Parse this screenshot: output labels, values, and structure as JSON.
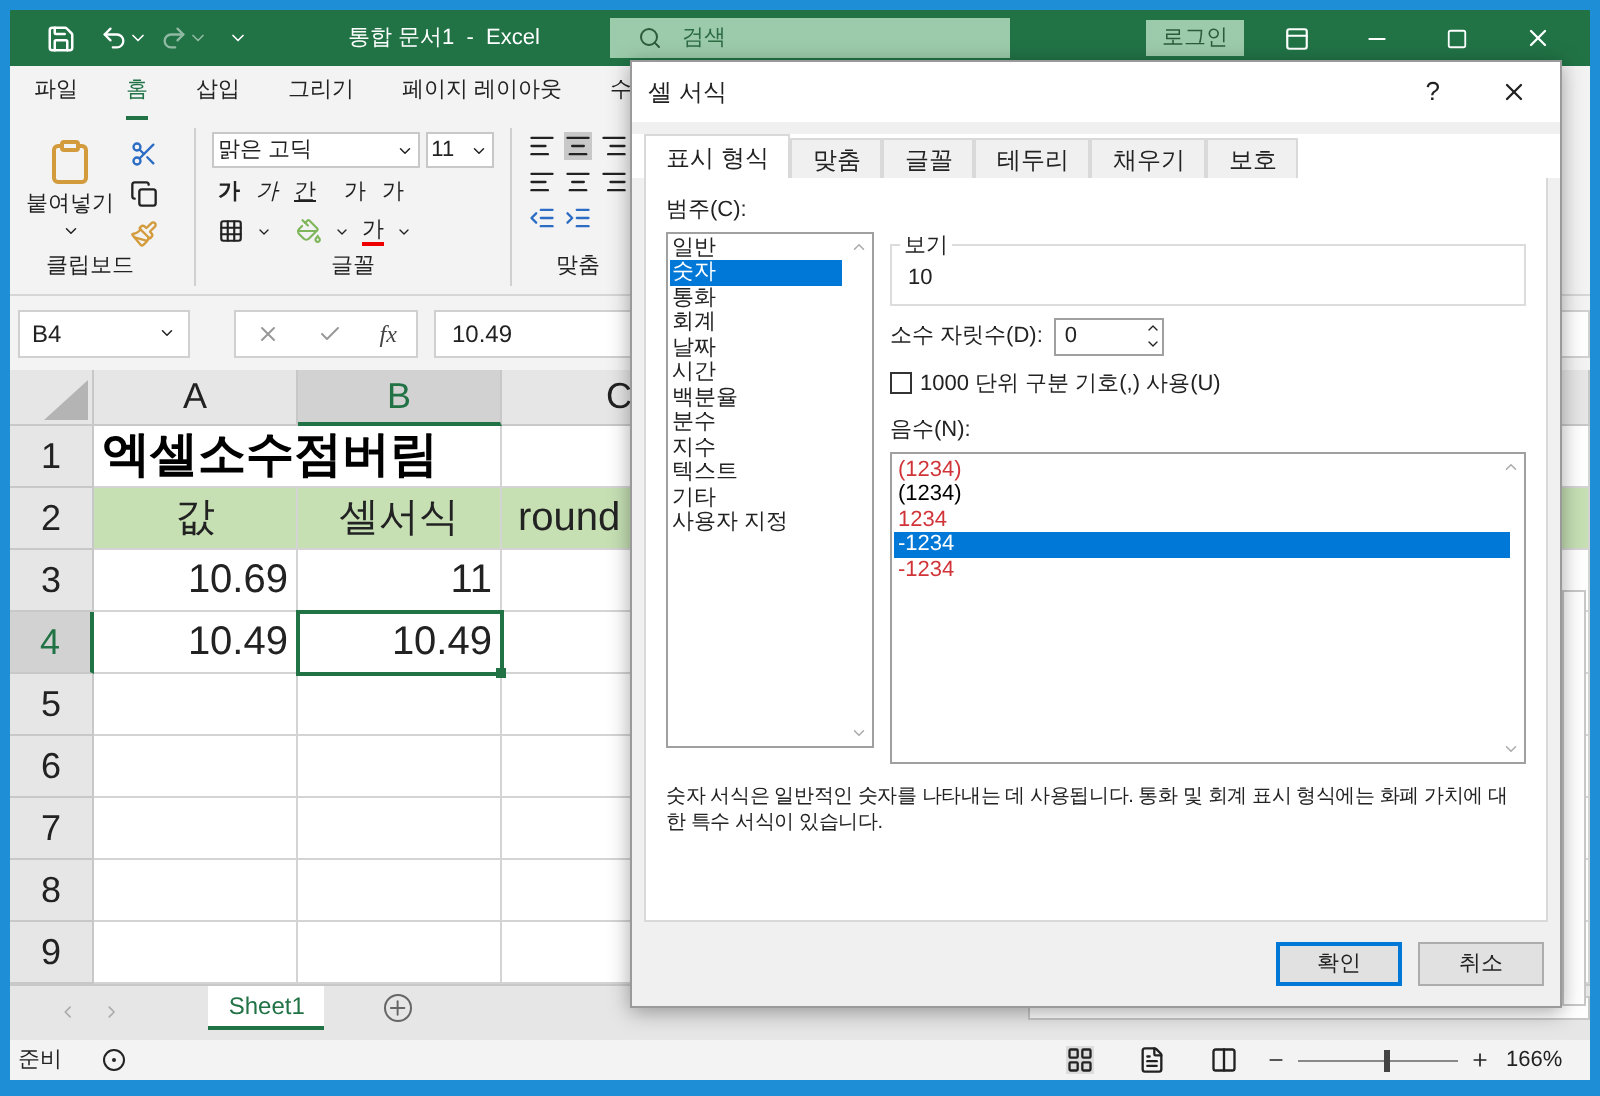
{
  "excel": {
    "title": "통합 문서1  -  Excel",
    "search": {
      "placeholder": "검색"
    },
    "signin": "로그인",
    "menu": [
      {
        "label": "파일",
        "selected": false
      },
      {
        "label": "홈",
        "selected": true
      },
      {
        "label": "삽입",
        "selected": false
      },
      {
        "label": "그리기",
        "selected": false
      },
      {
        "label": "페이지 레이아웃",
        "selected": false
      },
      {
        "label": "수",
        "selected": false
      }
    ],
    "ribbon": {
      "paste": "붙여넣기",
      "font_name": "맑은 고딕",
      "font_size": "11",
      "font_buttons": [
        "가",
        "가",
        "간",
        "가",
        "가"
      ],
      "font_color_glyph": "가",
      "groups": [
        "클립보드",
        "글꼴",
        "맞춤"
      ]
    },
    "name_box": "B4",
    "function_glyph": "fx",
    "formula": "10.49",
    "columns": [
      {
        "label": "A",
        "selected": false
      },
      {
        "label": "B",
        "selected": true
      },
      {
        "label": "C",
        "selected": false
      }
    ],
    "rows": [
      {
        "label": "1",
        "selected": false,
        "cells": [
          {
            "kind": "title",
            "text": "엑셀소수점버림",
            "selected": false
          },
          {
            "kind": "empty",
            "selected": false
          }
        ]
      },
      {
        "label": "2",
        "selected": false,
        "cells": [
          {
            "kind": "header",
            "text": "값",
            "selected": false
          },
          {
            "kind": "header",
            "text": "셀서식",
            "selected": false
          },
          {
            "kind": "header-left",
            "text": "round",
            "selected": false
          }
        ]
      },
      {
        "label": "3",
        "selected": false,
        "cells": [
          {
            "kind": "number",
            "text": "10.69",
            "selected": false
          },
          {
            "kind": "number",
            "text": "11",
            "selected": false
          },
          {
            "kind": "empty",
            "selected": false
          }
        ]
      },
      {
        "label": "4",
        "selected": true,
        "cells": [
          {
            "kind": "number",
            "text": "10.49",
            "selected": false
          },
          {
            "kind": "number",
            "text": "10.49",
            "selected": true
          },
          {
            "kind": "empty",
            "selected": false
          }
        ]
      },
      {
        "label": "5",
        "selected": false
      },
      {
        "label": "6",
        "selected": false
      },
      {
        "label": "7",
        "selected": false
      },
      {
        "label": "8",
        "selected": false
      },
      {
        "label": "9",
        "selected": false
      }
    ],
    "sheet_tabs": [
      {
        "label": "Sheet1",
        "selected": true
      }
    ],
    "status": "준비",
    "zoom": {
      "level": 0.55,
      "reading": "166%"
    }
  },
  "dialog": {
    "title": "셀 서식",
    "help": "?",
    "tabs": [
      {
        "label": "표시 형식",
        "selected": true
      },
      {
        "label": "맞춤",
        "selected": false
      },
      {
        "label": "글꼴",
        "selected": false
      },
      {
        "label": "테두리",
        "selected": false
      },
      {
        "label": "채우기",
        "selected": false
      },
      {
        "label": "보호",
        "selected": false
      }
    ],
    "category_label": "범주(C):",
    "categories": [
      {
        "label": "일반",
        "selected": false
      },
      {
        "label": "숫자",
        "selected": true
      },
      {
        "label": "통화",
        "selected": false
      },
      {
        "label": "회계",
        "selected": false
      },
      {
        "label": "날짜",
        "selected": false
      },
      {
        "label": "시간",
        "selected": false
      },
      {
        "label": "백분율",
        "selected": false
      },
      {
        "label": "분수",
        "selected": false
      },
      {
        "label": "지수",
        "selected": false
      },
      {
        "label": "텍스트",
        "selected": false
      },
      {
        "label": "기타",
        "selected": false
      },
      {
        "label": "사용자 지정",
        "selected": false
      }
    ],
    "sample_label": "보기",
    "sample": "10",
    "decimals_label": "소수 자릿수(D):",
    "decimals": "0",
    "separator": {
      "label": "1000 단위 구분 기호(,) 사용(U)",
      "checked": false
    },
    "negative_label": "음수(N):",
    "negatives": [
      {
        "label": "(1234)",
        "color": "#d13438",
        "selected": false
      },
      {
        "label": "(1234)",
        "color": "#000000",
        "selected": false
      },
      {
        "label": "1234",
        "color": "#d13438",
        "selected": false
      },
      {
        "label": "-1234",
        "selected": true
      },
      {
        "label": "-1234",
        "color": "#d13438",
        "selected": false
      }
    ],
    "description": "숫자 서식은 일반적인 숫자를 나타내는 데 사용됩니다. 통화 및 회계 표시 형식에는 화폐 가치에 대한 특수 서식이 있습니다.",
    "ok": "확인",
    "cancel": "취소"
  }
}
